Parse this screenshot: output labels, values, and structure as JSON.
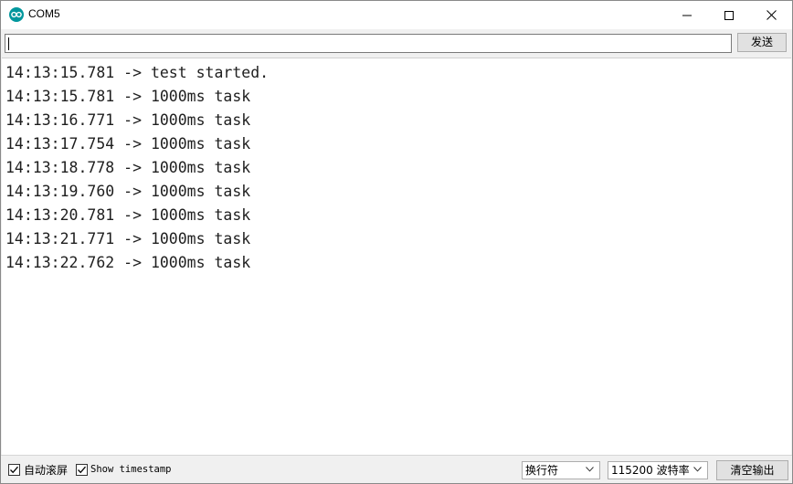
{
  "window": {
    "title": "COM5",
    "app_icon": "arduino-infinity-icon",
    "controls": [
      "minimize-icon",
      "maximize-icon",
      "close-icon"
    ]
  },
  "input_bar": {
    "value": "",
    "send_label": "发送"
  },
  "console": {
    "lines": [
      "14:13:15.781 -> test started.",
      "14:13:15.781 -> 1000ms task",
      "14:13:16.771 -> 1000ms task",
      "14:13:17.754 -> 1000ms task",
      "14:13:18.778 -> 1000ms task",
      "14:13:19.760 -> 1000ms task",
      "14:13:20.781 -> 1000ms task",
      "14:13:21.771 -> 1000ms task",
      "14:13:22.762 -> 1000ms task"
    ]
  },
  "footer": {
    "autoscroll_label": "自动滚屏",
    "autoscroll_checked": true,
    "timestamp_label": "Show timestamp",
    "timestamp_checked": true,
    "line_ending": "换行符",
    "baud_rate": "115200 波特率",
    "clear_label": "清空输出"
  },
  "colors": {
    "arduino_teal": "#00979d",
    "window_bg": "#f0f0f0",
    "console_bg": "#ffffff"
  }
}
